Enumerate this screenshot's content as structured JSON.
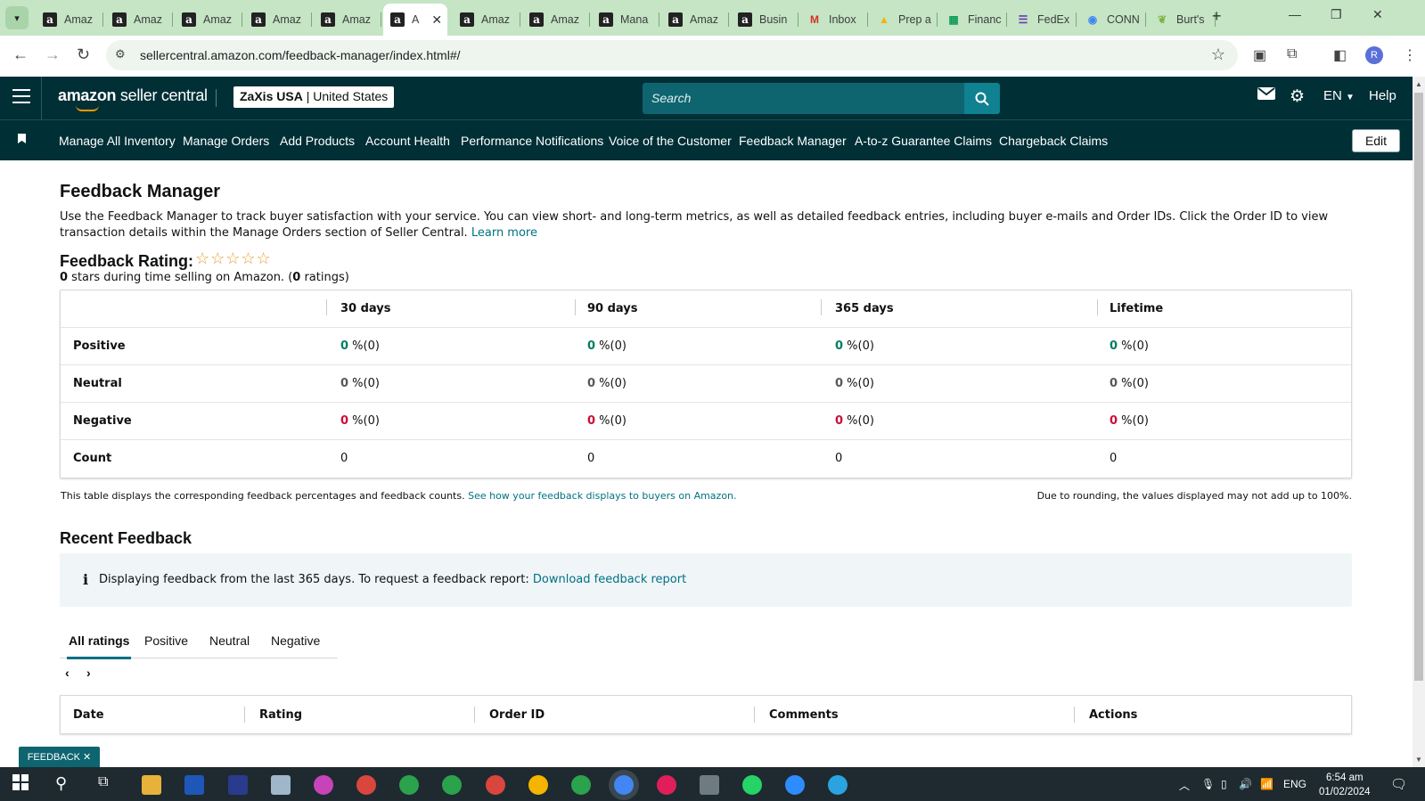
{
  "browser": {
    "tabs": [
      {
        "label": "Amaz",
        "icon": "amazon-icon"
      },
      {
        "label": "Amaz",
        "icon": "amazon-icon"
      },
      {
        "label": "Amaz",
        "icon": "amazon-icon"
      },
      {
        "label": "Amaz",
        "icon": "amazon-icon"
      },
      {
        "label": "Amaz",
        "icon": "amazon-icon"
      },
      {
        "label": "A",
        "icon": "amazon-icon",
        "active": true
      },
      {
        "label": "Amaz",
        "icon": "amazon-icon"
      },
      {
        "label": "Amaz",
        "icon": "amazon-icon"
      },
      {
        "label": "Mana",
        "icon": "amazon-icon"
      },
      {
        "label": "Amaz",
        "icon": "amazon-icon"
      },
      {
        "label": "Busin",
        "icon": "amazon-icon"
      },
      {
        "label": "Inbox",
        "icon": "gmail-icon"
      },
      {
        "label": "Prep a",
        "icon": "drive-icon"
      },
      {
        "label": "Financ",
        "icon": "sheets-icon"
      },
      {
        "label": "FedEx",
        "icon": "forms-icon"
      },
      {
        "label": "CONN",
        "icon": "chrome-icon"
      },
      {
        "label": "Burt's",
        "icon": "leaf-icon"
      }
    ],
    "url": "sellercentral.amazon.com/feedback-manager/index.html#/",
    "profile_initial": "R"
  },
  "header": {
    "logo_bold": "amazon",
    "logo_rest": " seller central",
    "store_name": "ZaXis USA",
    "store_sep": " | ",
    "store_region": "United States",
    "search_placeholder": "Search",
    "language": "EN",
    "help": "Help"
  },
  "nav": {
    "items": [
      "Manage All Inventory",
      "Manage Orders",
      "Add Products",
      "Account Health",
      "Performance Notifications",
      "Voice of the Customer",
      "Feedback Manager",
      "A-to-z Guarantee Claims",
      "Chargeback Claims"
    ],
    "edit": "Edit"
  },
  "page": {
    "title": "Feedback Manager",
    "description": "Use the Feedback Manager to track buyer satisfaction with your service. You can view short- and long-term metrics, as well as detailed feedback entries, including buyer e-mails and Order IDs. Click the Order ID to view transaction details within the Manage Orders section of Seller Central.",
    "learn_more": "Learn more",
    "rating_label": "Feedback Rating:",
    "stars": "☆☆☆☆☆",
    "rating_stars": "0",
    "rating_sub_a": " stars during time selling on Amazon. (",
    "rating_count": "0",
    "rating_sub_b": " ratings)"
  },
  "metrics": {
    "columns": [
      "30 days",
      "90 days",
      "365 days",
      "Lifetime"
    ],
    "rows": [
      {
        "label": "Positive",
        "values": [
          "0",
          "0",
          "0",
          "0"
        ],
        "suffix": " %(0)"
      },
      {
        "label": "Neutral",
        "values": [
          "0",
          "0",
          "0",
          "0"
        ],
        "suffix": " %(0)"
      },
      {
        "label": "Negative",
        "values": [
          "0",
          "0",
          "0",
          "0"
        ],
        "suffix": " %(0)"
      },
      {
        "label": "Count",
        "values": [
          "0",
          "0",
          "0",
          "0"
        ],
        "suffix": ""
      }
    ],
    "note": "This table displays the corresponding feedback percentages and feedback counts.",
    "note_link": "See how your feedback displays to buyers on Amazon.",
    "rounding_note": "Due to rounding, the values displayed may not add up to 100%."
  },
  "recent": {
    "title": "Recent Feedback",
    "info_text": "Displaying feedback from the last 365 days. To request a feedback report:",
    "info_link": "Download feedback report",
    "tabs": [
      "All ratings",
      "Positive",
      "Neutral",
      "Negative"
    ],
    "active_tab": "All ratings",
    "prev": "‹",
    "next": "›",
    "columns": [
      "Date",
      "Rating",
      "Order ID",
      "Comments",
      "Actions"
    ]
  },
  "feedback_widget": "FEEDBACK ✕",
  "taskbar": {
    "lang": "ENG",
    "time": "6:54 am",
    "date": "01/02/2024"
  },
  "colors": {
    "header_bg": "#002f36",
    "link": "#007185",
    "positive": "#067d62",
    "negative": "#cc0c39"
  }
}
